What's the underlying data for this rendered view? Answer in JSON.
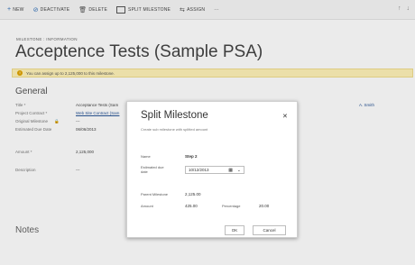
{
  "toolbar": {
    "items": [
      {
        "icon": "plus-icon",
        "label": "NEW"
      },
      {
        "icon": "deactivate-icon",
        "label": "DEACTIVATE"
      },
      {
        "icon": "delete-icon",
        "label": "DELETE"
      },
      {
        "icon": "split-milestone-icon",
        "label": "SPLIT MILESTONE"
      },
      {
        "icon": "assign-icon",
        "label": "ASSIGN"
      },
      {
        "icon": "more-icon",
        "label": "···"
      }
    ],
    "right_icons": [
      "up-arrow-icon",
      "down-arrow-icon"
    ]
  },
  "breadcrumb": "MILESTONE : INFORMATION",
  "page_title": "Acceptence Tests (Sample PSA)",
  "warning": "You can assign up to 2,125,000 to this milestone.",
  "general": {
    "heading": "General",
    "fields": [
      {
        "label": "Title *",
        "value": "Acceptance Tests (Sam"
      },
      {
        "label": "Project Contract *",
        "value": "Web Site Contract (Sam"
      },
      {
        "label": "Original Milestone",
        "value": "---"
      },
      {
        "label": "Estimated Due Date",
        "value": "06/06/2013"
      },
      {
        "label": "Amount *",
        "value": "2,125,000"
      },
      {
        "label": "Description",
        "value": "---"
      }
    ],
    "right_link": "A. Smith"
  },
  "notes_heading": "Notes",
  "dialog": {
    "title": "Split Milestone",
    "subtitle": "Create sub milestone with splitted amount",
    "name_label": "Name",
    "name_value": "Step 2",
    "due_label_line1": "Estimated due",
    "due_label_line2": "date",
    "due_value": "10/12/2013",
    "parent_label": "Parent Milestone",
    "parent_value": "2,125.00",
    "amount_label": "Amount",
    "amount_value": "425.00",
    "percentage_label": "Percentage",
    "percentage_value": "20.00",
    "ok_label": "OK",
    "cancel_label": "Cancel"
  }
}
